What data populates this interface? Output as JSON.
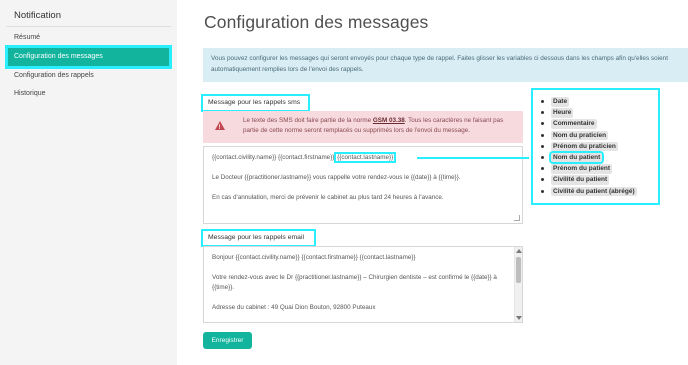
{
  "sidebar": {
    "title": "Notification",
    "items": [
      {
        "label": "Résumé"
      },
      {
        "label": "Configuration des messages"
      },
      {
        "label": "Configuration des rappels"
      },
      {
        "label": "Historique"
      }
    ]
  },
  "main": {
    "title": "Configuration des messages",
    "info": "Vous pouvez configurer les messages qui seront envoyés pour chaque type de rappel. Faites glisser les variables ci dessous dans les champs afin qu'elles soient automatiquement remplies lors de l'envoi des rappels."
  },
  "sms": {
    "label": "Message pour les rappels sms",
    "alert_prefix": "Le texte des SMS doit faire partie de la norme",
    "alert_norm": "GSM 03.38",
    "alert_suffix": ". Tous les caractères ne faisant pas partie de cette norme seront remplacés ou supprimés lors de l'envoi du message.",
    "line1_prefix": "{{contact.civility.name}} {{contact.firstname}} ",
    "line1_var": "{{contact.lastname}}",
    "line2": "Le Docteur {{practitioner.lastname}} vous rappelle votre rendez-vous le {{date}} à {{time}}.",
    "line3": "En cas d'annulation, merci de prévenir le cabinet au plus tard 24 heures à l'avance."
  },
  "email": {
    "label": "Message pour les rappels email",
    "line1": "Bonjour {{contact.civility.name}} {{contact.firstname}} {{contact.lastname}}",
    "line2": "Votre rendez-vous avec le Dr {{practitioner.lastname}} – Chirurgien dentiste – est confirmé le {{date}} à {{time}}.",
    "line3": "Adresse du cabinet : 49 Quai Dion Bouton, 92800 Puteaux"
  },
  "save_label": "Enregistrer",
  "variables": [
    {
      "label": "Date"
    },
    {
      "label": "Heure"
    },
    {
      "label": "Commentaire"
    },
    {
      "label": "Nom du praticien"
    },
    {
      "label": "Prénom du praticien"
    },
    {
      "label": "Nom du patient"
    },
    {
      "label": "Prénom du patient"
    },
    {
      "label": "Civilité du patient"
    },
    {
      "label": "Civilité du patient (abrégé)"
    }
  ],
  "colors": {
    "accent": "#12b49d",
    "highlight": "#29eeff",
    "info_bg": "#d9edf4",
    "alert_bg": "#f6dadd"
  }
}
